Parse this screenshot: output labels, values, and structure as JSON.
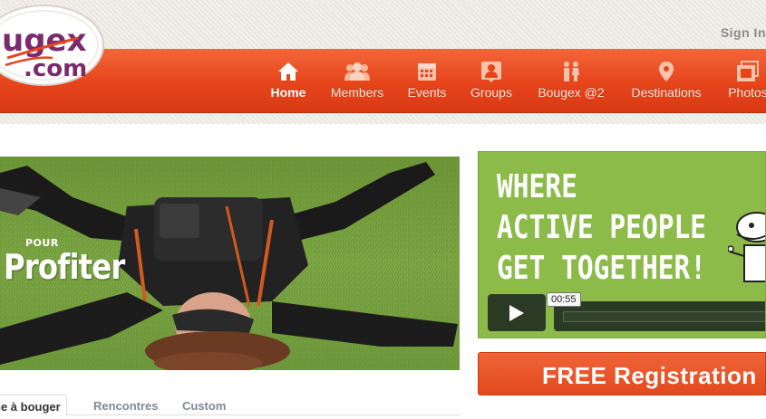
{
  "header": {
    "signin_label": "Sign In",
    "logo_text_top": "ugex",
    "logo_text_bottom": ".com"
  },
  "nav": {
    "items": [
      {
        "label": "Home",
        "icon": "home-icon",
        "active": true
      },
      {
        "label": "Members",
        "icon": "members-icon"
      },
      {
        "label": "Events",
        "icon": "calendar-icon"
      },
      {
        "label": "Groups",
        "icon": "groups-icon"
      },
      {
        "label": "Bougex @2",
        "icon": "couple-icon"
      },
      {
        "label": "Destinations",
        "icon": "map-pin-icon"
      },
      {
        "label": "Photos",
        "icon": "photos-icon"
      }
    ]
  },
  "hero": {
    "small_text": "POUR",
    "big_text": "Profiter"
  },
  "tabs": {
    "items": [
      "ne à bouger",
      "Rencontres",
      "Custom"
    ]
  },
  "video": {
    "slogan": [
      "WHERE",
      "ACTIVE PEOPLE",
      "GET TOGETHER!"
    ],
    "time": "00:55"
  },
  "register": {
    "label": "FREE Registration"
  },
  "colors": {
    "nav_orange": "#e6441b",
    "video_green": "#8cbb4a",
    "video_controls": "#2b3a25"
  }
}
